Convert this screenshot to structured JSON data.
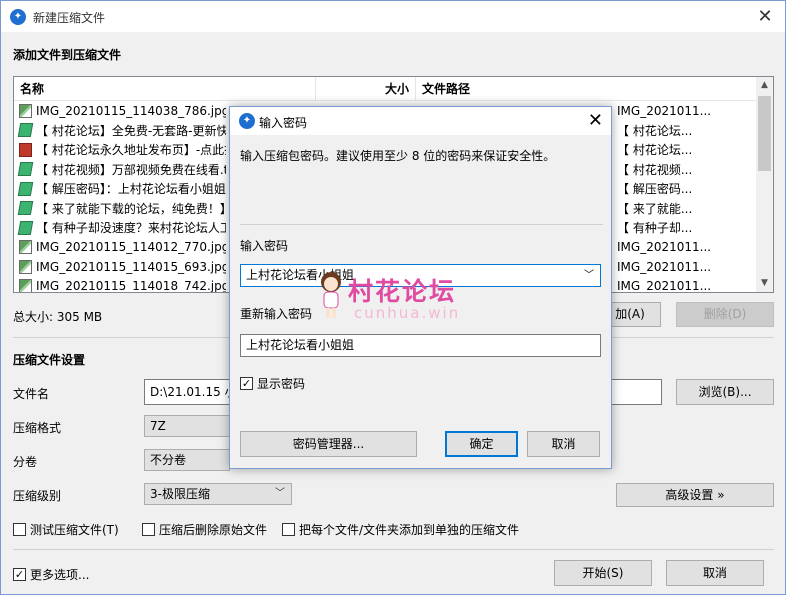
{
  "window": {
    "title": "新建压缩文件",
    "close": "✕"
  },
  "add_section": "添加文件到压缩文件",
  "list": {
    "headers": {
      "name": "名称",
      "size": "大小",
      "path": "文件路径"
    },
    "rows": [
      {
        "icon": "image-file-icon",
        "name": "IMG_20210115_114038_786.jpg",
        "path": "IMG_2021011..."
      },
      {
        "icon": "shortcut-file-icon",
        "name": "【 村花论坛】全免费-无套路-更新快",
        "path": "【 村花论坛..."
      },
      {
        "icon": "save-file-icon",
        "name": "【 村花论坛永久地址发布页】-点此打",
        "path": "【 村花论坛..."
      },
      {
        "icon": "shortcut-file-icon",
        "name": "【 村花视频】万部视频免费在线看.t",
        "path": "【 村花视频..."
      },
      {
        "icon": "shortcut-file-icon",
        "name": "【 解压密码】：上村花论坛看小姐姐",
        "path": "【 解压密码..."
      },
      {
        "icon": "shortcut-file-icon",
        "name": "【 来了就能下载的论坛，纯免费！】",
        "path": "【 来了就能..."
      },
      {
        "icon": "shortcut-file-icon",
        "name": "【 有种子却没速度？来村花论坛人工",
        "path": "【 有种子却..."
      },
      {
        "icon": "image-file-icon",
        "name": "IMG_20210115_114012_770.jpg",
        "path": "IMG_2021011..."
      },
      {
        "icon": "image-file-icon",
        "name": "IMG_20210115_114015_693.jpg",
        "path": "IMG_2021011..."
      },
      {
        "icon": "image-file-icon",
        "name": "IMG_20210115_114018_742.jpg",
        "path": "IMG_2021011..."
      }
    ]
  },
  "total_size": "总大小: 305 MB",
  "buttons": {
    "add_partial": "加(A)",
    "delete": "删除(D)",
    "browse": "浏览(B)...",
    "advanced": "高级设置 »",
    "start": "开始(S)",
    "cancel": "取消"
  },
  "settings": {
    "section": "压缩文件设置",
    "filename_label": "文件名",
    "filename_value": "D:\\21.01.15 小姐",
    "format_label": "压缩格式",
    "format_value": "7Z",
    "volume_label": "分卷",
    "volume_value": "不分卷",
    "level_label": "压缩级别",
    "level_value": "3-极限压缩"
  },
  "options": {
    "test": "测试压缩文件(T)",
    "delete_after": "压缩后删除原始文件",
    "separate": "把每个文件/文件夹添加到单独的压缩文件",
    "more": "更多选项..."
  },
  "dialog": {
    "title": "输入密码",
    "close": "✕",
    "message": "输入压缩包密码。建议使用至少 8 位的密码来保证安全性。",
    "password_label": "输入密码",
    "password_value": "上村花论坛看小姐姐",
    "confirm_label": "重新输入密码",
    "confirm_value": "上村花论坛看小姐姐",
    "show_password": "显示密码",
    "manager": "密码管理器...",
    "ok": "确定",
    "cancel": "取消"
  },
  "watermark": {
    "text": "村花论坛",
    "url": "cunhua.win"
  }
}
